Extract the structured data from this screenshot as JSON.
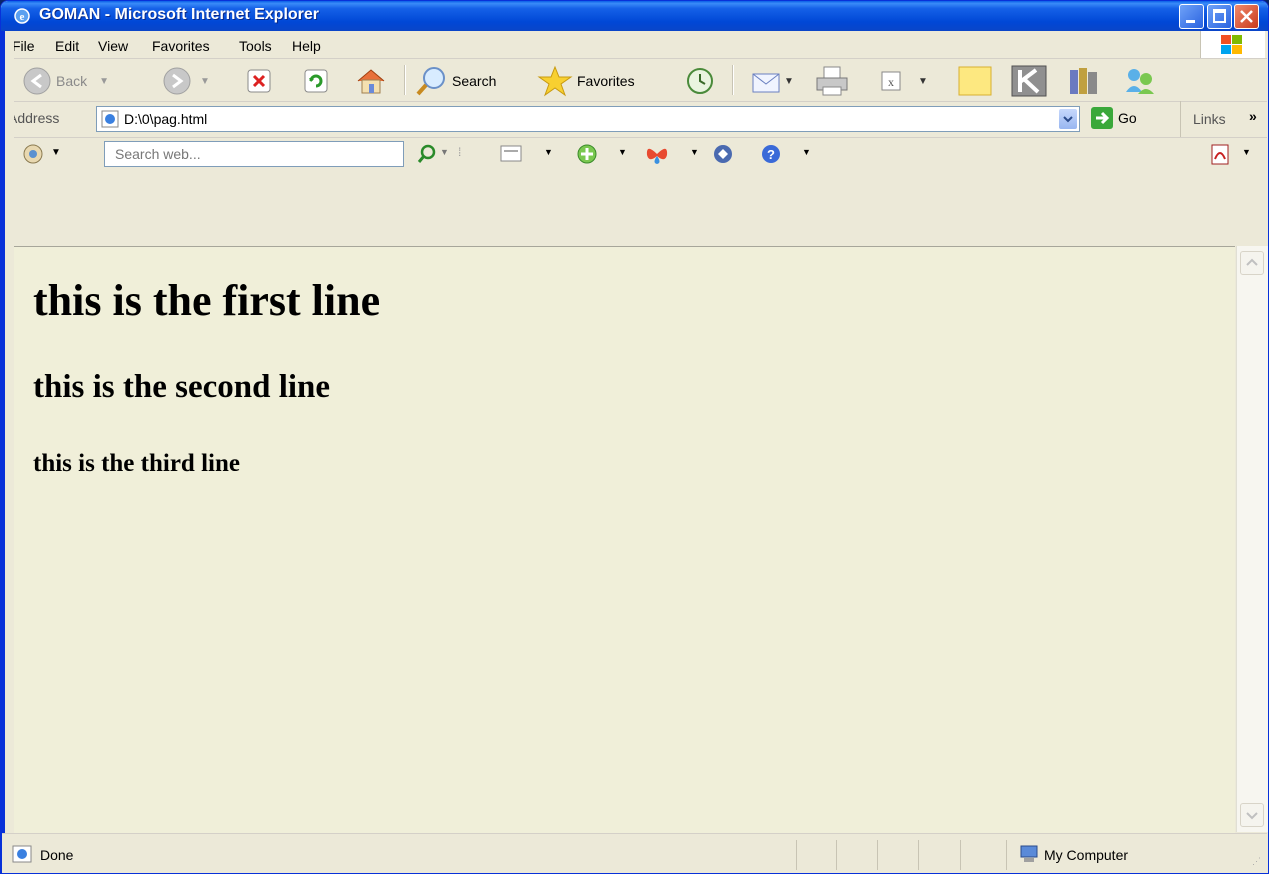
{
  "window": {
    "title": "GOMAN - Microsoft Internet Explorer"
  },
  "menu": {
    "items": [
      "File",
      "Edit",
      "View",
      "Favorites",
      "Tools",
      "Help"
    ]
  },
  "toolbar": {
    "back_label": "Back",
    "search_label": "Search",
    "favorites_label": "Favorites"
  },
  "address": {
    "label": "Address",
    "value": "D:\\0\\pag.html",
    "go_label": "Go",
    "links_label": "Links"
  },
  "searchbar": {
    "placeholder": "Search web..."
  },
  "content": {
    "line1": "this is the first line",
    "line2": "this is the second line",
    "line3": "this is the third line"
  },
  "status": {
    "text": "Done",
    "zone": "My Computer"
  },
  "colors": {
    "title_blue": "#0a5fe8",
    "chrome": "#ece9d8",
    "page_bg": "#f0efd9"
  }
}
